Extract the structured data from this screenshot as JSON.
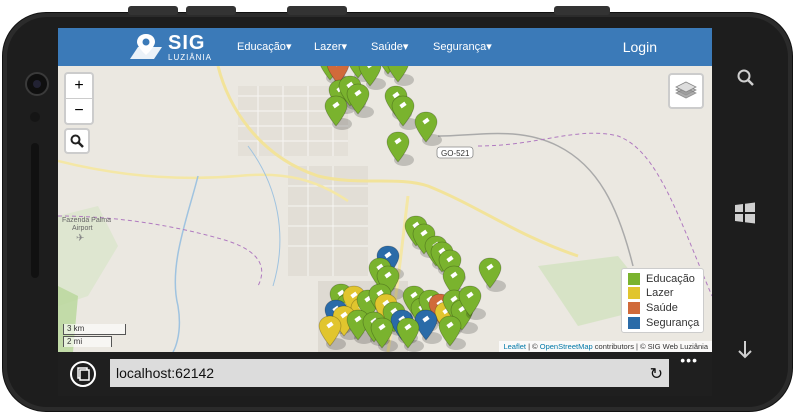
{
  "nav": {
    "logo_title": "SIG",
    "logo_subtitle": "LUZIÂNIA",
    "items": [
      {
        "label": "Educação"
      },
      {
        "label": "Lazer"
      },
      {
        "label": "Saúde"
      },
      {
        "label": "Segurança"
      }
    ],
    "login": "Login"
  },
  "map": {
    "labels": {
      "road": "GO-521",
      "airport_1": "Fazenda Palma",
      "airport_2": "Airport"
    },
    "zoom_in": "+",
    "zoom_out": "−",
    "scale_km": "3 km",
    "scale_mi": "2 mi",
    "legend": [
      {
        "label": "Educação",
        "color": "#7ab32e"
      },
      {
        "label": "Lazer",
        "color": "#e1c52e"
      },
      {
        "label": "Saúde",
        "color": "#d06a3a"
      },
      {
        "label": "Segurança",
        "color": "#2a6ba8"
      }
    ],
    "attribution": {
      "leaflet": "Leaflet",
      "sep1": " | © ",
      "osm": "OpenStreetMap",
      "rest": " contributors | © SIG Web Luziânia"
    }
  },
  "browser": {
    "url": "localhost:62142",
    "more": "•••"
  }
}
